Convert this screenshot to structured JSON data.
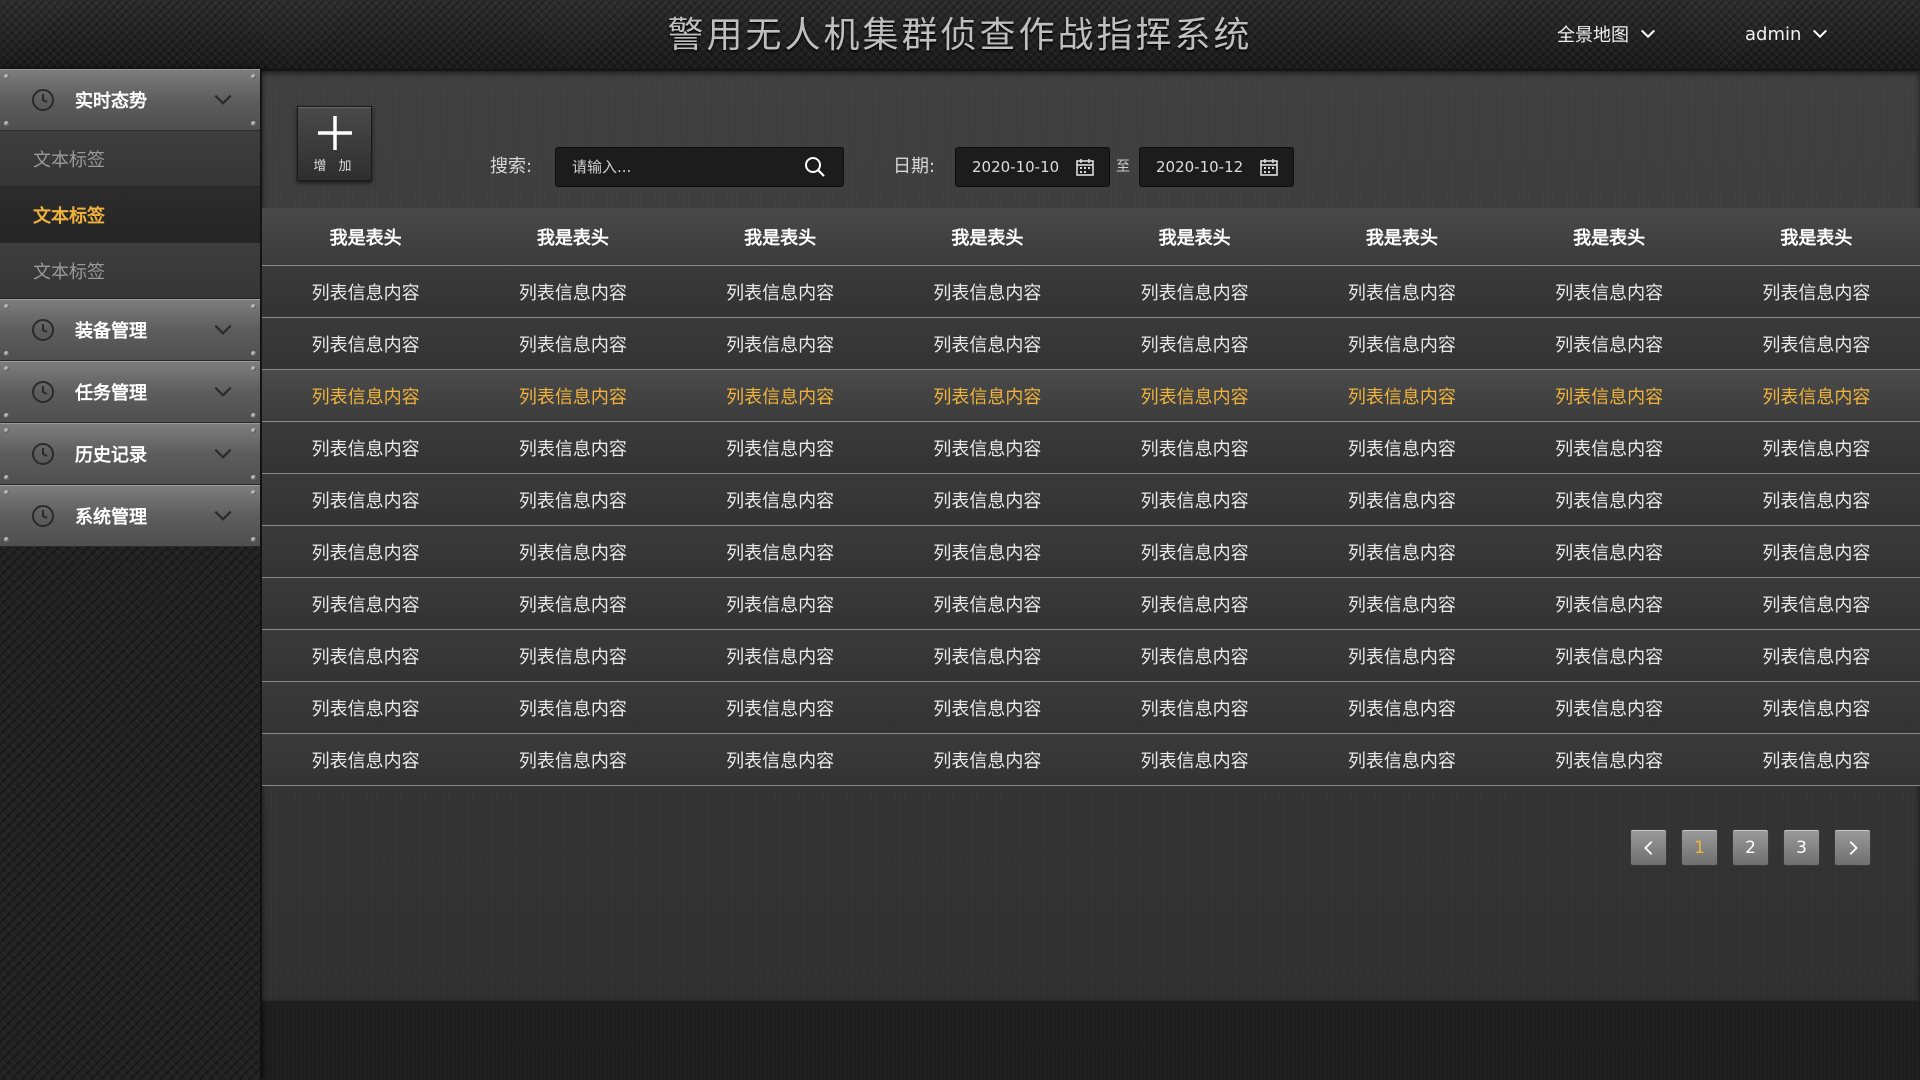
{
  "header": {
    "title": "警用无人机集群侦查作战指挥系统",
    "map_dropdown": "全景地图",
    "user_dropdown": "admin"
  },
  "sidebar": {
    "menus": [
      {
        "label": "实时态势",
        "icon": "clock-icon",
        "expanded": true,
        "children": [
          "文本标签",
          "文本标签",
          "文本标签"
        ],
        "active_child": 1
      },
      {
        "label": "装备管理",
        "icon": "clock-icon"
      },
      {
        "label": "任务管理",
        "icon": "clock-icon"
      },
      {
        "label": "历史记录",
        "icon": "clock-icon"
      },
      {
        "label": "系统管理",
        "icon": "clock-icon"
      }
    ]
  },
  "toolbar": {
    "add_label": "增 加",
    "search_label": "搜索:",
    "search_placeholder": "请输入...",
    "date_label": "日期:",
    "date_from": "2020-10-10",
    "date_to_sep": "至",
    "date_to": "2020-10-12"
  },
  "table": {
    "headers": [
      "我是表头",
      "我是表头",
      "我是表头",
      "我是表头",
      "我是表头",
      "我是表头",
      "我是表头",
      "我是表头"
    ],
    "rows": [
      [
        "列表信息内容",
        "列表信息内容",
        "列表信息内容",
        "列表信息内容",
        "列表信息内容",
        "列表信息内容",
        "列表信息内容",
        "列表信息内容"
      ],
      [
        "列表信息内容",
        "列表信息内容",
        "列表信息内容",
        "列表信息内容",
        "列表信息内容",
        "列表信息内容",
        "列表信息内容",
        "列表信息内容"
      ],
      [
        "列表信息内容",
        "列表信息内容",
        "列表信息内容",
        "列表信息内容",
        "列表信息内容",
        "列表信息内容",
        "列表信息内容",
        "列表信息内容"
      ],
      [
        "列表信息内容",
        "列表信息内容",
        "列表信息内容",
        "列表信息内容",
        "列表信息内容",
        "列表信息内容",
        "列表信息内容",
        "列表信息内容"
      ],
      [
        "列表信息内容",
        "列表信息内容",
        "列表信息内容",
        "列表信息内容",
        "列表信息内容",
        "列表信息内容",
        "列表信息内容",
        "列表信息内容"
      ],
      [
        "列表信息内容",
        "列表信息内容",
        "列表信息内容",
        "列表信息内容",
        "列表信息内容",
        "列表信息内容",
        "列表信息内容",
        "列表信息内容"
      ],
      [
        "列表信息内容",
        "列表信息内容",
        "列表信息内容",
        "列表信息内容",
        "列表信息内容",
        "列表信息内容",
        "列表信息内容",
        "列表信息内容"
      ],
      [
        "列表信息内容",
        "列表信息内容",
        "列表信息内容",
        "列表信息内容",
        "列表信息内容",
        "列表信息内容",
        "列表信息内容",
        "列表信息内容"
      ],
      [
        "列表信息内容",
        "列表信息内容",
        "列表信息内容",
        "列表信息内容",
        "列表信息内容",
        "列表信息内容",
        "列表信息内容",
        "列表信息内容"
      ],
      [
        "列表信息内容",
        "列表信息内容",
        "列表信息内容",
        "列表信息内容",
        "列表信息内容",
        "列表信息内容",
        "列表信息内容",
        "列表信息内容"
      ]
    ],
    "active_row": 2
  },
  "pagination": {
    "pages": [
      "1",
      "2",
      "3"
    ],
    "current": 0
  },
  "colors": {
    "accent": "#f0b33c",
    "text": "#eaeaea",
    "panel": "#3a3a3a"
  }
}
